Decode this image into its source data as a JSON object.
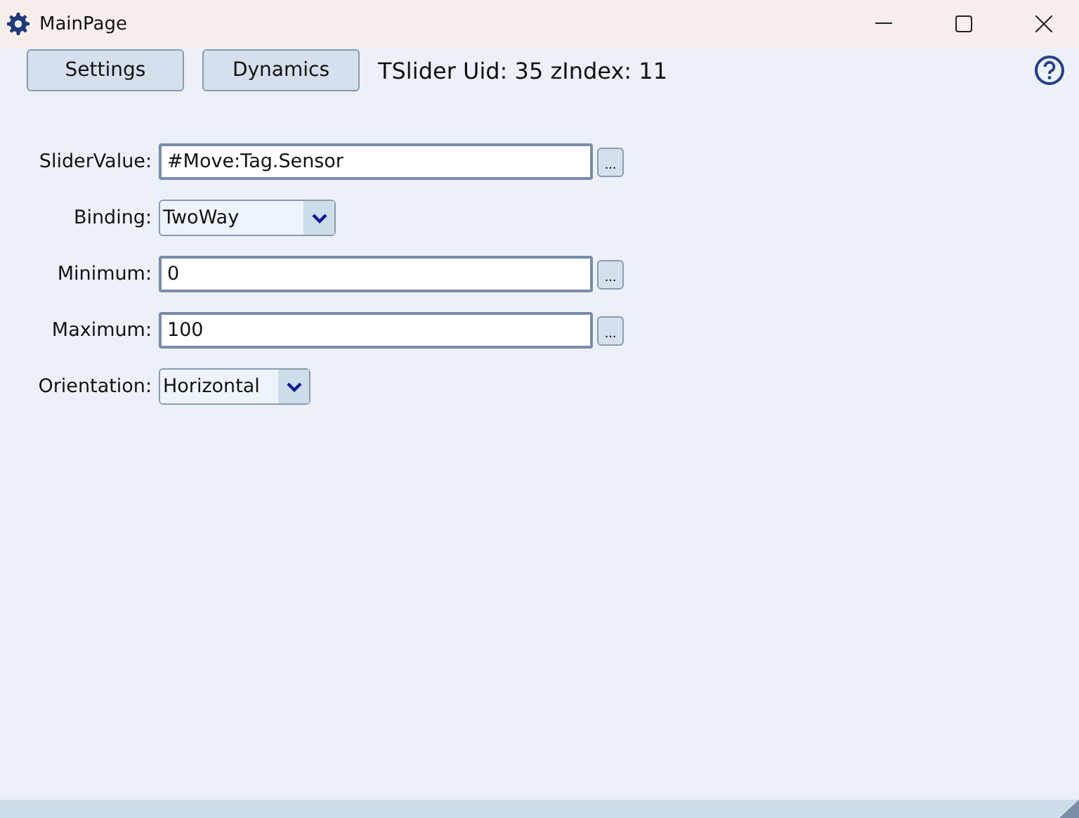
{
  "window": {
    "title": "MainPage"
  },
  "toolbar": {
    "buttons": [
      "Settings",
      "Dynamics"
    ],
    "info": "TSlider Uid: 35 zIndex: 11"
  },
  "fields": [
    {
      "kind": "text",
      "label": "SliderValue:",
      "value": "#Move:Tag.Sensor",
      "browse": "..."
    },
    {
      "kind": "combo",
      "label": "Binding:",
      "value": "TwoWay"
    },
    {
      "kind": "text",
      "label": "Minimum:",
      "value": "0",
      "browse": "..."
    },
    {
      "kind": "text",
      "label": "Maximum:",
      "value": "100",
      "browse": "..."
    },
    {
      "kind": "combo",
      "label": "Orientation:",
      "value": "Horizontal"
    }
  ]
}
